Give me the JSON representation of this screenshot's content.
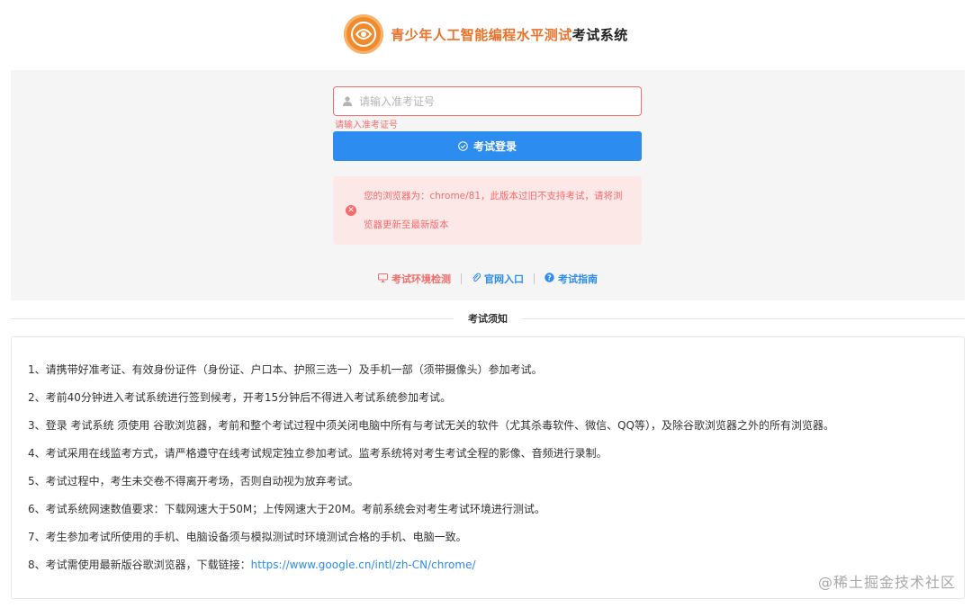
{
  "header": {
    "title_main": "青少年人工智能编程水平测试",
    "title_sub": "考试系统",
    "colors": {
      "accent": "#e8732c"
    }
  },
  "login": {
    "placeholder": "请输入准考证号",
    "error_tip": "请输入准考证号",
    "button_label": "考试登录",
    "alert_line1": "您的浏览器为：chrome/81，此版本过旧不支持考试，请将浏",
    "alert_line2": "览器更新至最新版本"
  },
  "links": [
    {
      "label": "考试环境检测",
      "icon": "monitor-icon"
    },
    {
      "label": "官网入口",
      "icon": "paperclip-icon"
    },
    {
      "label": "考试指南",
      "icon": "help-icon"
    }
  ],
  "divider_label": "考试须知",
  "notices": [
    "1、请携带好准考证、有效身份证件（身份证、户口本、护照三选一）及手机一部（须带摄像头）参加考试。",
    "2、考前40分钟进入考试系统进行签到候考，开考15分钟后不得进入考试系统参加考试。",
    "3、登录 考试系统 须使用 谷歌浏览器，考前和整个考试过程中须关闭电脑中所有与考试无关的软件（尤其杀毒软件、微信、QQ等），及除谷歌浏览器之外的所有浏览器。",
    "4、考试采用在线监考方式，请严格遵守在线考试规定独立参加考试。监考系统将对考生考试全程的影像、音频进行录制。",
    "5、考试过程中，考生未交卷不得离开考场，否则自动视为放弃考试。",
    "6、考试系统网速数值要求：下载网速大于50M；上传网速大于20M。考前系统会对考生考试环境进行测试。",
    "7、考生参加考试所使用的手机、电脑设备须与模拟测试时环境测试合格的手机、电脑一致。"
  ],
  "notice8_prefix": "8、考试需使用最新版谷歌浏览器，下载链接：",
  "notice8_link": "https://www.google.cn/intl/zh-CN/chrome/",
  "watermark": "@稀土掘金技术社区"
}
